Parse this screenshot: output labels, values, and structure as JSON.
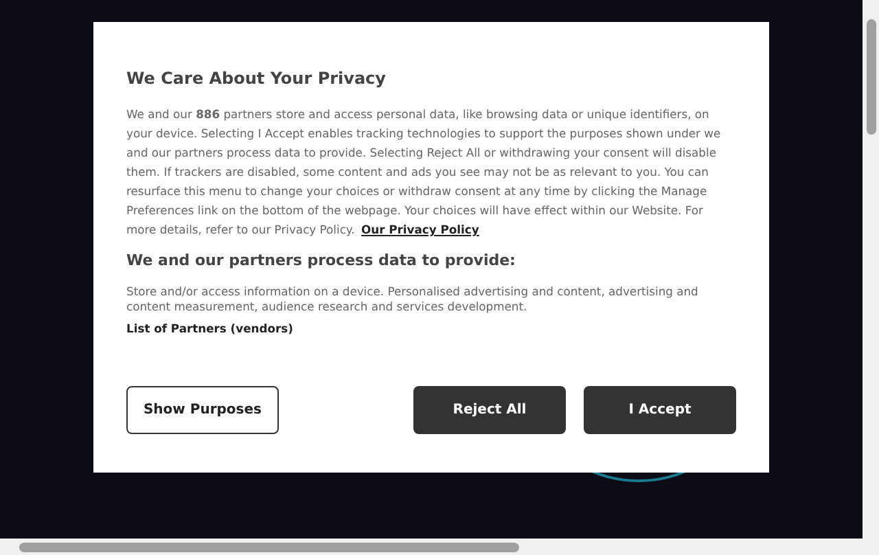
{
  "dialog": {
    "title": "We Care About Your Privacy",
    "body": "We and our **886** partners store and access personal data, like browsing data or unique identifiers, on your device. Selecting I Accept enables tracking technologies to support the purposes shown under we and our partners process data to provide. Selecting Reject All or withdrawing your consent will disable them. If trackers are disabled, some content and ads you see may not be as relevant to you. You can resurface this menu to change your choices or withdraw consent at any time by clicking the Manage Preferences link on the bottom of the webpage. Your choices will have effect within our Website. For more details, refer to our Privacy Policy.",
    "privacy_link": "Our Privacy Policy",
    "subtitle": "We and our partners process data to provide:",
    "purposes": "Store and/or access information on a device. Personalised advertising and content, advertising and content measurement, audience research and services development.",
    "partners_link": "List of Partners (vendors)",
    "buttons": [
      {
        "label": "Show Purposes",
        "kind": "outline"
      },
      {
        "label": "Reject All",
        "kind": "filled"
      },
      {
        "label": "I Accept",
        "kind": "filled"
      }
    ]
  }
}
